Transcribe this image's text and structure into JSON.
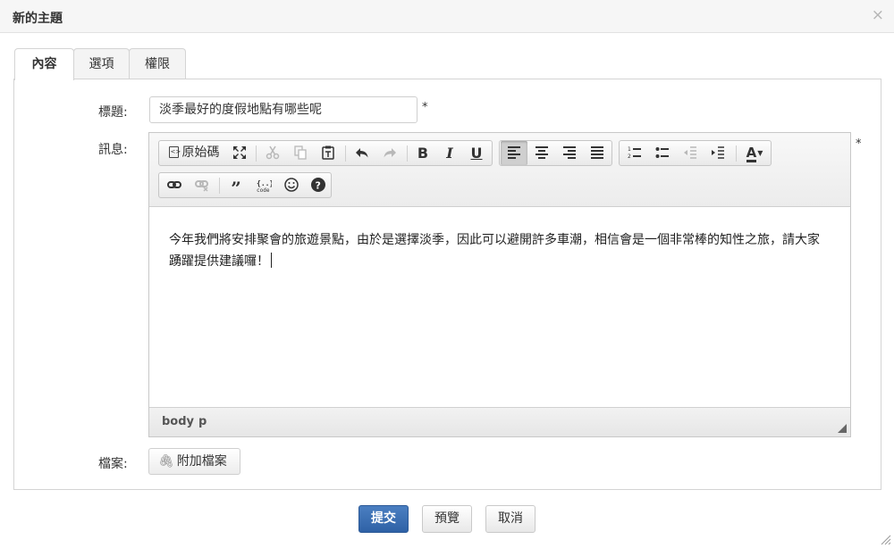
{
  "dialog": {
    "title": "新的主題",
    "close_glyph": "×"
  },
  "tabs": [
    {
      "label": "內容",
      "active": true
    },
    {
      "label": "選項",
      "active": false
    },
    {
      "label": "權限",
      "active": false
    }
  ],
  "form": {
    "subject_label": "標題:",
    "subject_value": "淡季最好的度假地點有哪些呢",
    "required_mark": "*",
    "message_label": "訊息:",
    "attach_label": "檔案:",
    "attach_button": "附加檔案"
  },
  "toolbar": {
    "source_label": "原始碼",
    "groups_row1": [
      "source",
      "maximize",
      "cut",
      "copy",
      "paste-text",
      "undo",
      "redo",
      "bold",
      "italic",
      "underline",
      "align-left",
      "align-center",
      "align-right",
      "justify",
      "numbered-list",
      "bulleted-list",
      "outdent",
      "indent",
      "text-color"
    ],
    "groups_row2": [
      "link",
      "unlink",
      "blockquote",
      "code-snippet",
      "emoji",
      "help"
    ],
    "bold": "B",
    "italic": "I",
    "underline": "U",
    "text_color": "A"
  },
  "editor": {
    "content": "今年我們將安排聚會的旅遊景點，由於是選擇淡季，因此可以避開許多車潮，相信會是一個非常棒的知性之旅，請大家踴躍提供建議囉！",
    "path": [
      "body",
      "p"
    ]
  },
  "actions": {
    "submit": "提交",
    "preview": "預覽",
    "cancel": "取消"
  },
  "colors": {
    "primary": "#3a6db3",
    "border": "#d4d4d4"
  }
}
